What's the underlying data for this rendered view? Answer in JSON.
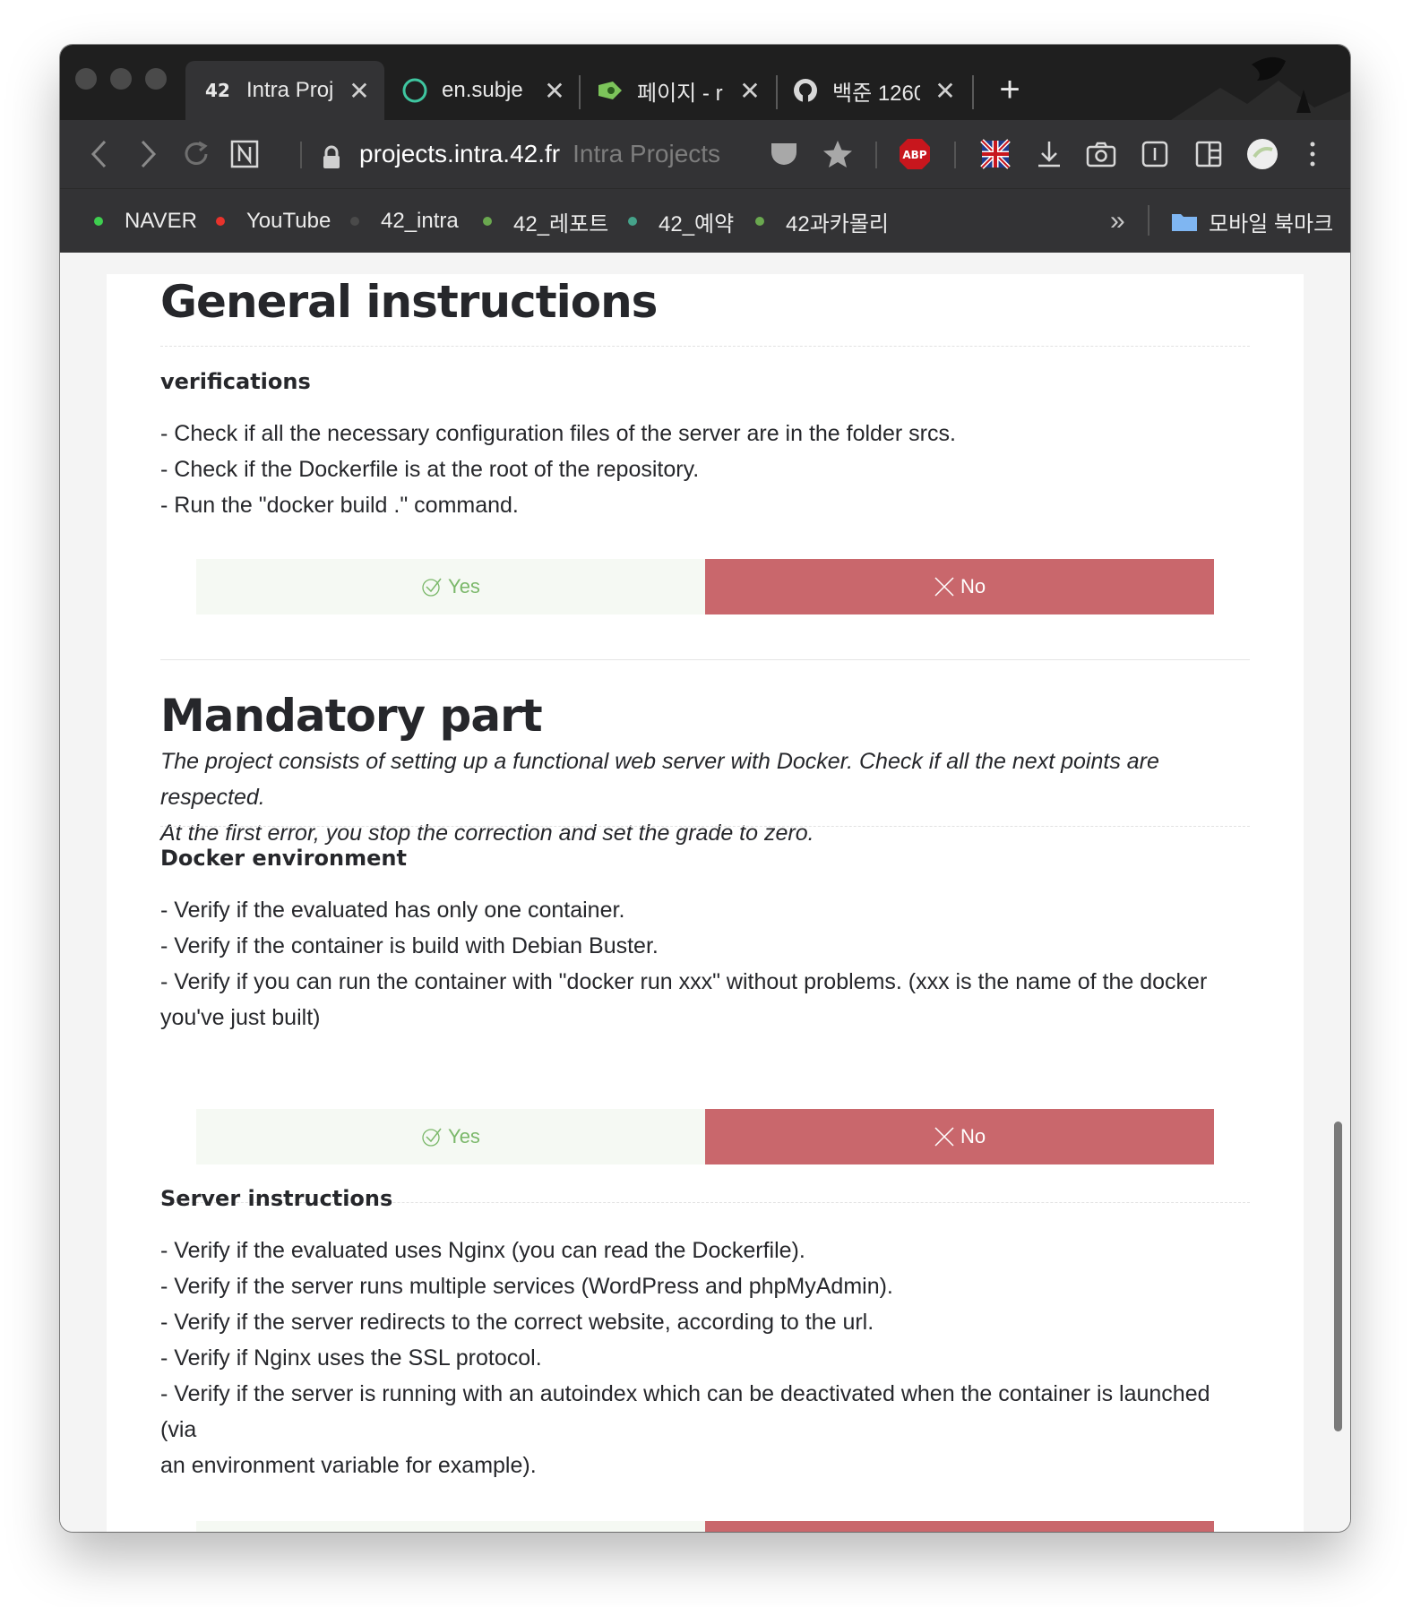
{
  "browser": {
    "tabs": [
      {
        "title": "Intra Proj",
        "icon": "42-logo-icon",
        "active": true
      },
      {
        "title": "en.subje",
        "icon": "circle-icon",
        "active": false
      },
      {
        "title": "페이지 - r",
        "icon": "tag-icon",
        "active": false
      },
      {
        "title": "백준 1260",
        "icon": "github-icon",
        "active": false
      }
    ],
    "new_tab": "+",
    "close_glyph": "✕",
    "address": {
      "host": "projects.intra.42.fr",
      "page_title": "Intra Projects"
    },
    "extensions": {
      "abp": "ABP"
    },
    "bookmarks": [
      {
        "label": "NAVER",
        "color": "#3ecf4f"
      },
      {
        "label": "YouTube",
        "color": "#e8332c"
      },
      {
        "label": "42_intra",
        "color": "#4a4a4a"
      },
      {
        "label": "42_레포트",
        "color": "#6aa84f"
      },
      {
        "label": "42_예약",
        "color": "#45a38a"
      },
      {
        "label": "42과카몰리",
        "color": "#6aa84f"
      }
    ],
    "bookmarks_more": "»",
    "mobile_bookmarks": "모바일 북마크"
  },
  "page": {
    "general": {
      "title": "General instructions",
      "subtitle": "verifications",
      "lines": [
        "- Check if all the necessary configuration files of the server are in the folder srcs.",
        "- Check if the Dockerfile is at the root of the repository.",
        "- Run the \"docker build .\" command."
      ]
    },
    "mandatory": {
      "title": "Mandatory part",
      "intro": [
        "The project consists of setting up a functional web server with Docker. Check if all the next points are respected.",
        "At the first error, you stop the correction and set the grade to zero."
      ],
      "docker": {
        "subtitle": "Docker environment",
        "lines": [
          "- Verify if the evaluated has only one container.",
          "- Verify if the container is build with Debian Buster.",
          "- Verify if you can run the container with \"docker run xxx\" without problems. (xxx is the name of the docker",
          "you've just built)"
        ]
      },
      "server": {
        "subtitle": "Server instructions",
        "lines": [
          "- Verify if the evaluated uses Nginx (you can read the Dockerfile).",
          "- Verify if the server runs multiple services (WordPress and phpMyAdmin).",
          "- Verify if the server redirects to the correct website, according to the url.",
          "- Verify if Nginx uses the SSL protocol.",
          "- Verify if the server is running with an autoindex which can be deactivated when the container is launched (via",
          "an environment variable for example)."
        ]
      }
    },
    "buttons": {
      "yes": "Yes",
      "no": "No"
    },
    "colors": {
      "yes_text": "#7bb86a",
      "yes_bg": "#f5f9f3",
      "no_bg": "#c9676c"
    }
  }
}
